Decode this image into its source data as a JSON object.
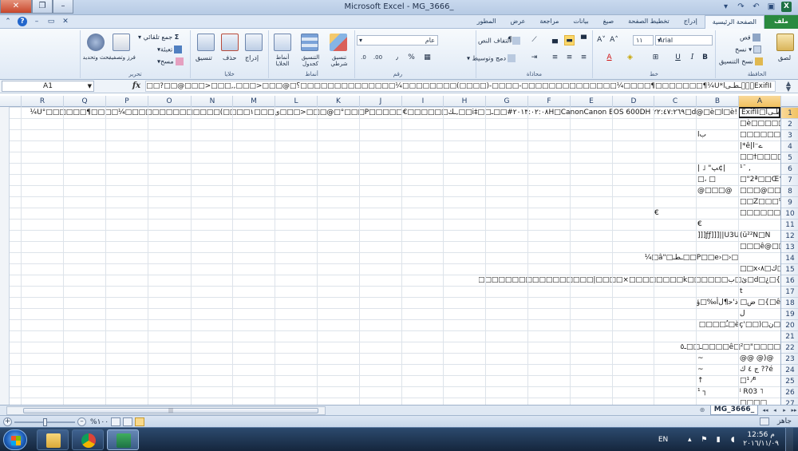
{
  "window": {
    "title": "Microsoft Excel - MG_3666_",
    "minimize_label": "–",
    "restore_label": "❐",
    "close_label": "✕"
  },
  "tabs": [
    {
      "label": "ملف",
      "key": "file"
    },
    {
      "label": "الصفحة الرئيسية",
      "key": "home"
    },
    {
      "label": "إدراج",
      "key": "insert"
    },
    {
      "label": "تخطيط الصفحة",
      "key": "page-layout"
    },
    {
      "label": "صيغ",
      "key": "formulas"
    },
    {
      "label": "بيانات",
      "key": "data"
    },
    {
      "label": "مراجعة",
      "key": "review"
    },
    {
      "label": "عرض",
      "key": "view"
    },
    {
      "label": "المطور",
      "key": "developer"
    }
  ],
  "ribbon": {
    "clipboard": {
      "group": "الحافظة",
      "paste": "لصق",
      "cut": "قص",
      "copy": "نسخ",
      "format_painter": "نسخ التنسيق"
    },
    "font": {
      "group": "خط",
      "font_name": "Arial",
      "font_size": "١١",
      "bold": "B",
      "italic": "I",
      "underline": "U"
    },
    "alignment": {
      "group": "محاذاة",
      "wrap_text": "التفاف النص",
      "merge_center": "دمج وتوسيط"
    },
    "number": {
      "group": "رقم",
      "format": "عام",
      "percent": "%",
      "comma": "٫"
    },
    "styles": {
      "group": "أنماط",
      "conditional": "تنسيق شرطي",
      "format_table": "التنسيق كجدول",
      "cell_styles": "أنماط الخلايا"
    },
    "cells": {
      "group": "خلايا",
      "insert": "إدراج",
      "delete": "حذف",
      "format": "تنسيق"
    },
    "editing": {
      "group": "تحرير",
      "autosum": "جمع تلقائي",
      "fill": "تعبئة",
      "clear": "مسح",
      "sort_filter": "فرز وتصفية",
      "find_select": "بحث وتحديد"
    }
  },
  "formula_bar": {
    "name_box": "A1",
    "fx_label": "fx",
    "content": "ExifII\u0000\u0000\u0000ـطـى‌ا*U¼¶□□□□□□□¶□□□□¼□□□□□□□□□□□□□□-□□□□-(□□□□)□□□□□□□□¼□□□□□□□□□□□□□□؟□@□□□<□□□,,□□□<□□□@□□?□□□P□□□□□□□□□□□□□□□□□ك□□□,□□،□□□٢٠١٣:٠٢:٠٨H□CanonCanon EOS 600DH#"
  },
  "columns": [
    "A",
    "B",
    "C",
    "D",
    "E",
    "F",
    "G",
    "H",
    "I",
    "J",
    "K",
    "L",
    "M",
    "N",
    "O",
    "P",
    "Q",
    "R"
  ],
  "rows": [
    "1",
    "2",
    "3",
    "4",
    "5",
    "6",
    "7",
    "8",
    "9",
    "10",
    "11",
    "12",
    "13",
    "14",
    "15",
    "16",
    "17",
    "18",
    "19",
    "20",
    "21",
    "22",
    "23",
    "24",
    "25",
    "26",
    "27"
  ],
  "cells": {
    "r1_A": "ExifII□ـطـى‌ا",
    "r1_wide": "!d@□è□l□è□٢٢:٤٧:٢٦٩ ٢٠١٣:٠٢:٠٨H□CanonCanon EOS 600DH#□□ـ□□‡i□□,ـك□□□□□□€□□□□□P□□□°□@□□□<□□□ى□□□١□□□□)□□□□□□□□□□□□□□¼□□□□¶□□□□□□°U¼",
    "r2_A": "□è□□□□□□□",
    "r3_A": "□□□□□□□□□",
    "r3_B": "ب‌ا",
    "r4_A": "|*ê|ے⁻ا",
    "r5_A": "□□†□□□□□",
    "r6_A": "¹¯ ,",
    "r6_B": "| ˩   \"ﭗ¢|",
    "r7_A": "□\"2ª□□Œ°",
    "r7_B": "□، □",
    "r8_A": "□□□@□□ô",
    "r8_B": "@□□□@",
    "r9_A": "□□Z□□□⁹",
    "r10_A": "□□□□□□□",
    "r10_C": "€",
    "r11_B": "€",
    "r12_A": "(ü²²N□N",
    "r12_B": "]]]ƒƒ]]]||U3U|||",
    "r13_A": "□□□ê@□□",
    "r14_wide": "□‹□‹P□□e□□ـطـ□\"â□¼",
    "r15_A": "□□x‹ك□٨□",
    "r16_wide": "}□¿□d□ئ□ب□□□□□□k□□□□□□□□×□□□□|□□□□□□□□□□□□□□□□□□□س",
    "r17_A": "t",
    "r18_wide": "ê□}□    ض□ ذ'ﺣ¶ﻝﺃ‰□ؤ",
    "r19_A": "ل",
    "r20_wide": "□ن□(□□'èç□ـٌ□□□□",
    "r22_wide": "□□□□\"□ê□²□□□□ـ□□ـ٥",
    "r23_A": "@@ @)@",
    "r23_B": "~",
    "r24_A": "ج ٤ ﻙ ‌?‌?‌é",
    "r24_B": "~",
    "r25_A": "□¹  ⁄ᴮ",
    "r25_B": "↑",
    "r26_A": "ʲ  R03 ˥",
    "r26_B": "¹ ┐",
    "r27_A": "□□□□"
  },
  "sheet": {
    "tab_name": "MG_3666_",
    "status": "جاهز",
    "zoom": "%١٠٠"
  },
  "taskbar": {
    "lang": "EN",
    "time": "12:56 م",
    "date": "٢٠١٦/١١/٠٩"
  },
  "colors": {
    "file_tab": "#2a8a3f",
    "selection": "#f1c15f",
    "taskbar": "#1d3350"
  }
}
